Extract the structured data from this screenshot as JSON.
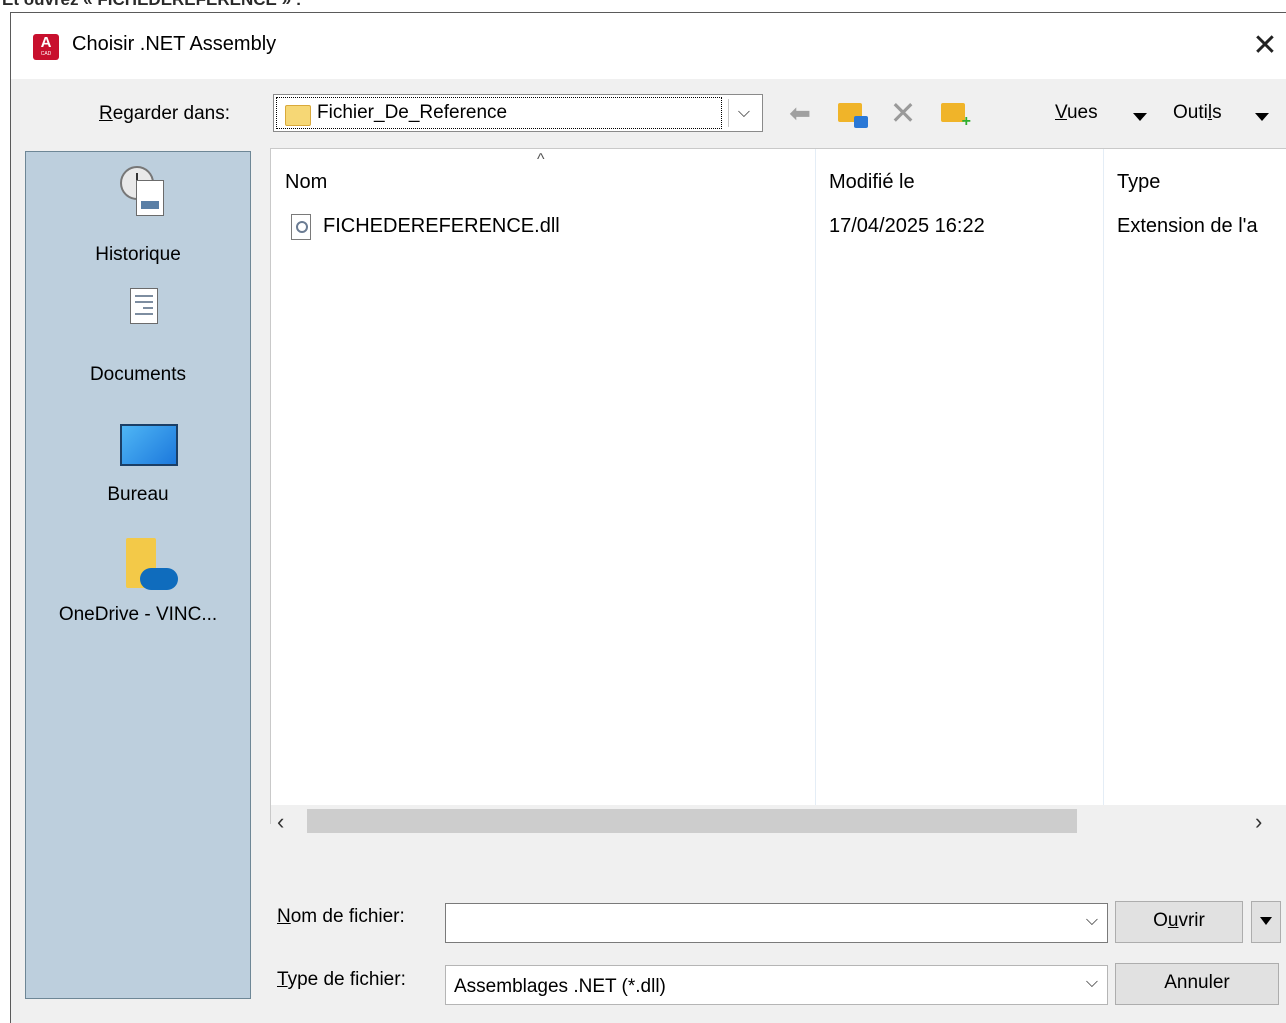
{
  "page_caption": "Et ouvrez « FICHEDEREFERENCE » :",
  "dialog": {
    "title": "Choisir .NET Assembly",
    "close_glyph": "✕",
    "app_icon_letter": "A",
    "app_icon_sub": "CAD"
  },
  "toolbar": {
    "lookin_label_accel": "R",
    "lookin_label_rest": "egarder dans:",
    "lookin_value": "Fichier_De_Reference",
    "views_accel": "V",
    "views_rest": "ues",
    "tools_prefix": "Outi",
    "tools_accel": "l",
    "tools_suffix": "s"
  },
  "places": [
    {
      "label": "Historique",
      "icon": "history-icon"
    },
    {
      "label": "Documents",
      "icon": "documents-icon"
    },
    {
      "label": "Bureau",
      "icon": "desktop-icon"
    },
    {
      "label": "OneDrive - VINC...",
      "icon": "onedrive-icon"
    }
  ],
  "file_list": {
    "columns": [
      "Nom",
      "Modifié le",
      "Type"
    ],
    "rows": [
      {
        "name": "FICHEDEREFERENCE.dll",
        "modified": "17/04/2025 16:22",
        "type": "Extension de l'a"
      }
    ]
  },
  "footer": {
    "filename_label_accel": "N",
    "filename_label_rest": "om de fichier:",
    "filename_value": "",
    "filetype_label_accel": "T",
    "filetype_label_rest": "ype de fichier:",
    "filetype_value": "Assemblages .NET (*.dll)",
    "open_prefix": "O",
    "open_accel": "u",
    "open_suffix": "vrir",
    "cancel_label": "Annuler"
  },
  "colors": {
    "places_bg": "#bdcfdd",
    "dialog_bg": "#f0f0f0",
    "app_icon": "#c8102e"
  }
}
